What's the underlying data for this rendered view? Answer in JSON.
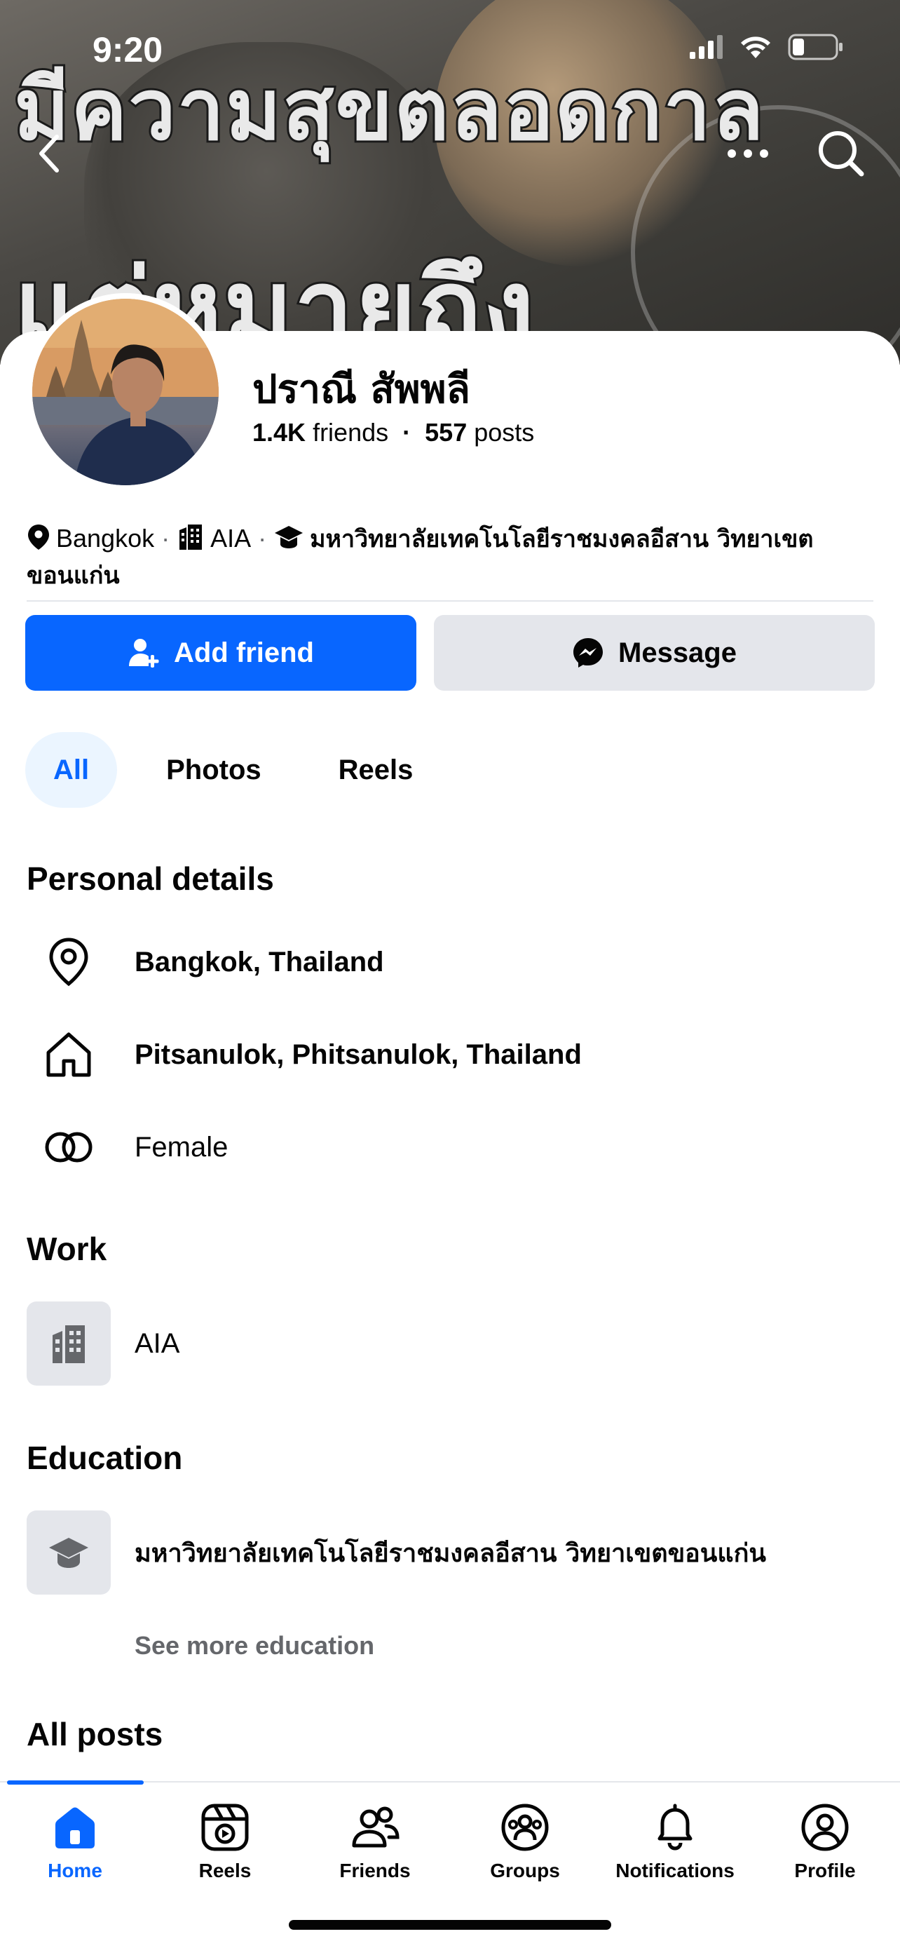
{
  "status_bar": {
    "time": "9:20"
  },
  "cover": {
    "text_line1": "มีความสุขตลอดกาล",
    "text_line2": "แต่หมายถึง"
  },
  "profile": {
    "name": "ปราณี สัพพลี",
    "friends_count": "1.4K",
    "friends_label": "friends",
    "posts_count": "557",
    "posts_label": "posts",
    "separator": "·"
  },
  "intro": {
    "location": "Bangkok",
    "work": "AIA",
    "education": "มหาวิทยาลัยเทคโนโลยีราชมงคลอีสาน วิทยาเขตขอนแก่น",
    "dot": "·"
  },
  "actions": {
    "add_friend": "Add friend",
    "message": "Message"
  },
  "filters": {
    "items": [
      "All",
      "Photos",
      "Reels"
    ],
    "selected": "All"
  },
  "personal_details": {
    "title": "Personal details",
    "current_city": "Bangkok, Thailand",
    "hometown": "Pitsanulok, Phitsanulok, Thailand",
    "gender": "Female"
  },
  "work": {
    "title": "Work",
    "employer": "AIA"
  },
  "education": {
    "title": "Education",
    "school": "มหาวิทยาลัยเทคโนโลยีราชมงคลอีสาน วิทยาเขตขอนแก่น",
    "see_more": "See more education"
  },
  "all_posts": {
    "title": "All posts"
  },
  "tabbar": {
    "items": [
      "Home",
      "Reels",
      "Friends",
      "Groups",
      "Notifications",
      "Profile"
    ],
    "active": "Home"
  },
  "colors": {
    "accent": "#0866ff",
    "chip_bg": "#ebf5ff",
    "secondary_btn": "#e4e6eb",
    "muted_text": "#65676b"
  },
  "icons": [
    "back-icon",
    "more-icon",
    "search-icon",
    "location-pin-icon",
    "building-icon",
    "graduation-cap-icon",
    "add-person-icon",
    "messenger-icon",
    "home-outline-icon",
    "gender-icon",
    "home-icon",
    "reels-icon",
    "friends-icon",
    "groups-icon",
    "bell-icon",
    "profile-icon"
  ]
}
